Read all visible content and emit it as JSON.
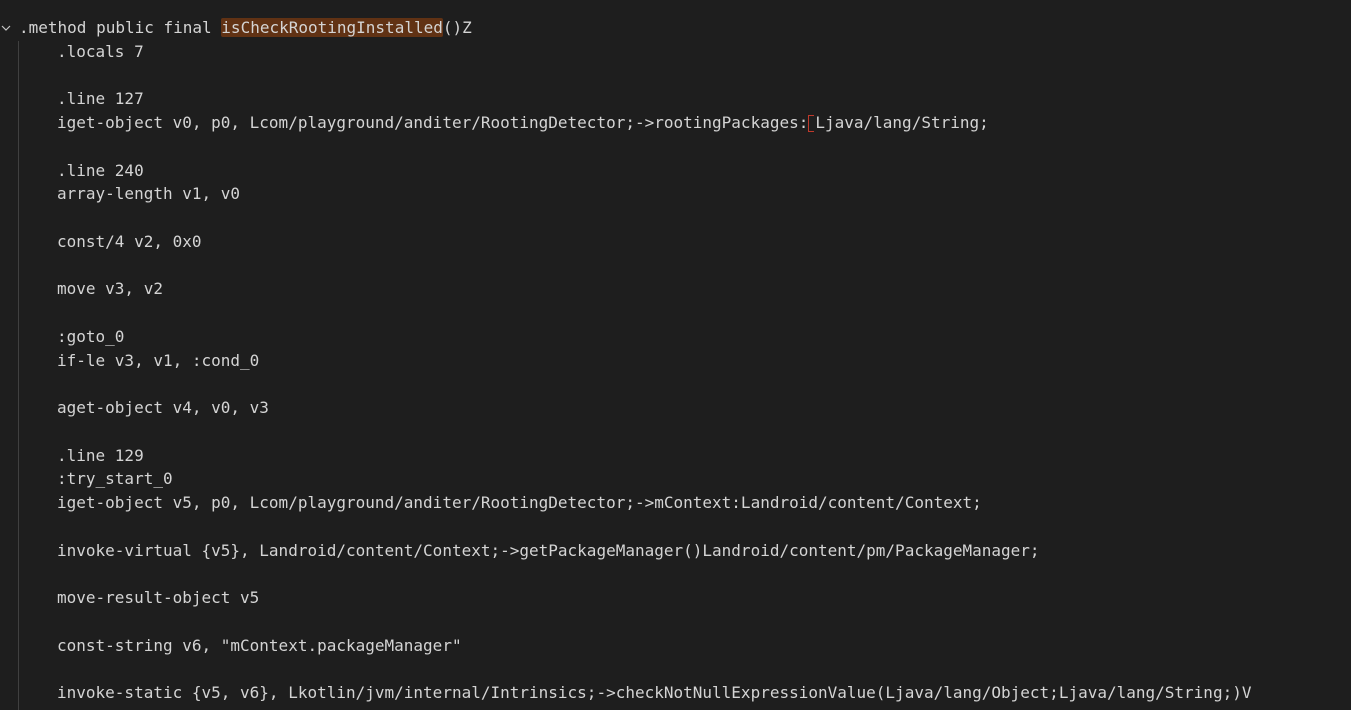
{
  "editor": {
    "method_header": {
      "prefix": ".method public final ",
      "highlighted_name": "isCheckRootingInstalled",
      "suffix": "()Z"
    },
    "lines": [
      ".locals 7",
      "",
      ".line 127",
      "iget-object v0, p0, Lcom/playground/anditer/RootingDetector;->rootingPackages:[Ljava/lang/String;",
      "",
      ".line 240",
      "array-length v1, v0",
      "",
      "const/4 v2, 0x0",
      "",
      "move v3, v2",
      "",
      ":goto_0",
      "if-le v3, v1, :cond_0",
      "",
      "aget-object v4, v0, v3",
      "",
      ".line 129",
      ":try_start_0",
      "iget-object v5, p0, Lcom/playground/anditer/RootingDetector;->mContext:Landroid/content/Context;",
      "",
      "invoke-virtual {v5}, Landroid/content/Context;->getPackageManager()Landroid/content/pm/PackageManager;",
      "",
      "move-result-object v5",
      "",
      "const-string v6, \"mContext.packageManager\"",
      "",
      "invoke-static {v5, v6}, Lkotlin/jvm/internal/Intrinsics;->checkNotNullExpressionValue(Ljava/lang/Object;Ljava/lang/String;)V"
    ],
    "iget_line": {
      "before_bracket": "iget-object v0, p0, Lcom/playground/anditer/RootingDetector;->rootingPackages:",
      "after_bracket": "Ljava/lang/String;"
    },
    "icons": {
      "fold": "chevron-down-icon"
    },
    "colors": {
      "background": "#1e1e1e",
      "text": "#d4d4d4",
      "highlight": "#613214",
      "bracket_marker": "#c0392b"
    }
  }
}
